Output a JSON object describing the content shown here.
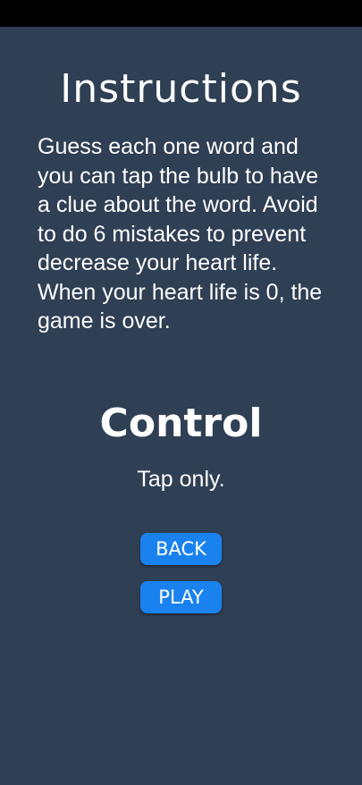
{
  "colors": {
    "background": "#2f3f54",
    "status_bar": "#000000",
    "button": "#1a82ef",
    "text": "#ffffff"
  },
  "instructions": {
    "title": "Instructions",
    "body": "Guess each one word and you can tap the bulb to have a clue about the word. Avoid to do 6 mistakes to prevent decrease your heart life. When your heart life is 0, the game is over."
  },
  "control": {
    "title": "Control",
    "body": "Tap only."
  },
  "buttons": {
    "back_label": "BACK",
    "play_label": "PLAY"
  }
}
